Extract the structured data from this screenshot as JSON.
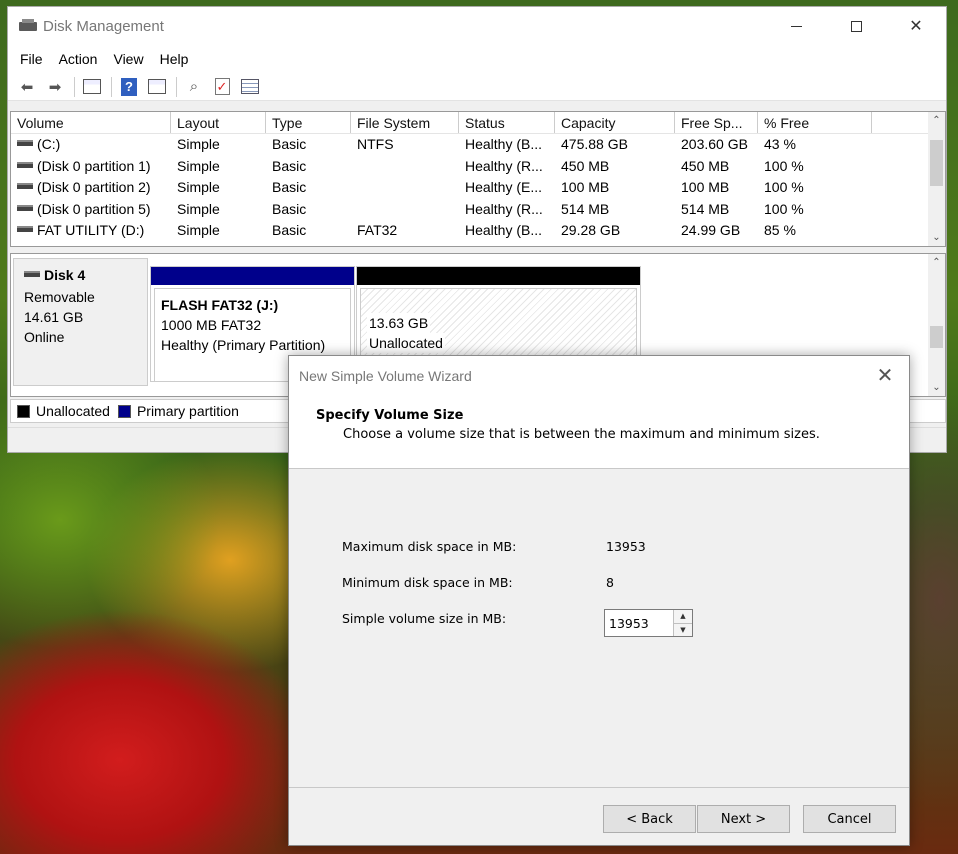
{
  "window": {
    "title": "Disk Management",
    "menu": [
      "File",
      "Action",
      "View",
      "Help"
    ]
  },
  "volume_list": {
    "columns": [
      "Volume",
      "Layout",
      "Type",
      "File System",
      "Status",
      "Capacity",
      "Free Sp...",
      "% Free"
    ],
    "rows": [
      [
        "(C:)",
        "Simple",
        "Basic",
        "NTFS",
        "Healthy (B...",
        "475.88 GB",
        "203.60 GB",
        "43 %"
      ],
      [
        "(Disk 0 partition 1)",
        "Simple",
        "Basic",
        "",
        "Healthy (R...",
        "450 MB",
        "450 MB",
        "100 %"
      ],
      [
        "(Disk 0 partition 2)",
        "Simple",
        "Basic",
        "",
        "Healthy (E...",
        "100 MB",
        "100 MB",
        "100 %"
      ],
      [
        "(Disk 0 partition 5)",
        "Simple",
        "Basic",
        "",
        "Healthy (R...",
        "514 MB",
        "514 MB",
        "100 %"
      ],
      [
        "FAT UTILITY (D:)",
        "Simple",
        "Basic",
        "FAT32",
        "Healthy (B...",
        "29.28 GB",
        "24.99 GB",
        "85 %"
      ]
    ]
  },
  "disk": {
    "name": "Disk 4",
    "kind": "Removable",
    "size": "14.61 GB",
    "state": "Online",
    "partitions": [
      {
        "name": "FLASH FAT32  (J:)",
        "size": "1000 MB FAT32",
        "status": "Healthy (Primary Partition)",
        "color": "#00008b"
      },
      {
        "size": "13.63 GB",
        "status": "Unallocated",
        "color": "#000000"
      }
    ]
  },
  "legend": [
    {
      "label": "Unallocated",
      "color": "#000000"
    },
    {
      "label": "Primary partition",
      "color": "#00008b"
    }
  ],
  "wizard": {
    "title": "New Simple Volume Wizard",
    "heading": "Specify Volume Size",
    "subheading": "Choose a volume size that is between the maximum and minimum sizes.",
    "max_label": "Maximum disk space in MB:",
    "max_value": "13953",
    "min_label": "Minimum disk space in MB:",
    "min_value": "8",
    "size_label": "Simple volume size in MB:",
    "size_value": "13953",
    "back_label": "< Back",
    "next_label": "Next >",
    "cancel_label": "Cancel"
  }
}
